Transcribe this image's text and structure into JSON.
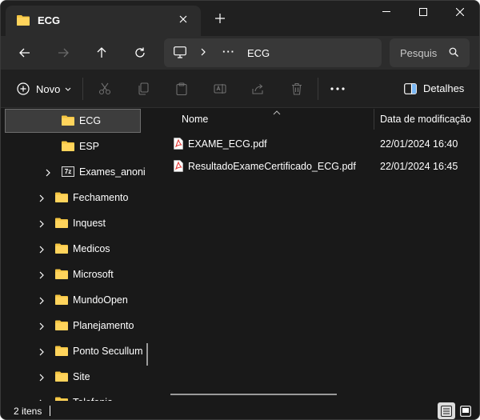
{
  "tab": {
    "title": "ECG"
  },
  "address": {
    "crumb": "ECG",
    "more": "···"
  },
  "search": {
    "placeholder": "Pesquisar"
  },
  "toolbar": {
    "new_label": "Novo",
    "details_label": "Detalhes"
  },
  "sidebar": {
    "items": [
      {
        "label": "ECG",
        "icon": "folder-icon",
        "selected": true
      },
      {
        "label": "ESP",
        "icon": "folder-icon"
      },
      {
        "label": "Exames_anonimizados",
        "icon": "7z-archive-icon",
        "expandable": true
      },
      {
        "label": "Fechamento",
        "icon": "folder-icon",
        "expandable": true
      },
      {
        "label": "Inquest",
        "icon": "folder-icon",
        "expandable": true
      },
      {
        "label": "Medicos",
        "icon": "folder-icon",
        "expandable": true
      },
      {
        "label": "Microsoft",
        "icon": "folder-icon",
        "expandable": true
      },
      {
        "label": "MundoOpen",
        "icon": "folder-icon",
        "expandable": true
      },
      {
        "label": "Planejamento",
        "icon": "folder-icon",
        "expandable": true
      },
      {
        "label": "Ponto Secullum",
        "icon": "folder-icon",
        "expandable": true
      },
      {
        "label": "Site",
        "icon": "folder-icon",
        "expandable": true
      },
      {
        "label": "Telefonia",
        "icon": "folder-icon",
        "expandable": true
      }
    ]
  },
  "columns": {
    "name": "Nome",
    "date": "Data de modificação"
  },
  "files": [
    {
      "name": "EXAME_ECG.pdf",
      "date": "22/01/2024 16:40",
      "icon": "pdf-icon"
    },
    {
      "name": "ResultadoExameCertificado_ECG.pdf",
      "date": "22/01/2024 16:45",
      "icon": "pdf-icon"
    }
  ],
  "status": {
    "count": "2 itens"
  },
  "colors": {
    "folder": "#f4c542",
    "pdf": "#e53935",
    "window": "#191919",
    "chrome": "#202020"
  }
}
